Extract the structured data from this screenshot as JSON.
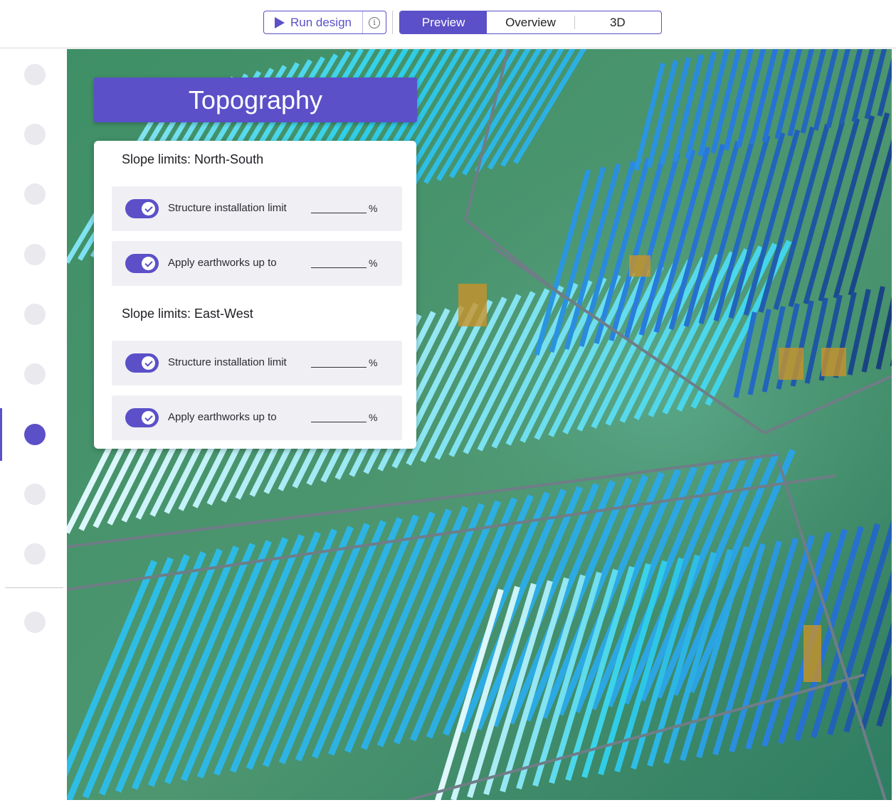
{
  "toolbar": {
    "run_label": "Run design",
    "run_icon": "play-icon",
    "info_icon": "info-icon",
    "info_glyph": "i",
    "tabs": [
      {
        "label": "Preview",
        "active": true
      },
      {
        "label": "Overview",
        "active": false
      },
      {
        "label": "3D",
        "active": false
      }
    ]
  },
  "rail": {
    "steps_active_index": 6,
    "step_count": 10
  },
  "panel": {
    "title": "Topography",
    "sections": [
      {
        "label": "Slope limits: North-South",
        "rows": [
          {
            "label": "Structure installation limit",
            "value": "",
            "unit": "%",
            "enabled": true
          },
          {
            "label": "Apply earthworks up to",
            "value": "",
            "unit": "%",
            "enabled": true
          }
        ]
      },
      {
        "label": "Slope limits: East-West",
        "rows": [
          {
            "label": "Structure installation limit",
            "value": "",
            "unit": "%",
            "enabled": true
          },
          {
            "label": "Apply earthworks up to",
            "value": "",
            "unit": "%",
            "enabled": true
          }
        ]
      }
    ]
  },
  "colors": {
    "accent": "#5b50c8",
    "terrain": "#4f9168",
    "road": "#6f7d86",
    "panel_low": "#ffffff",
    "panel_mid": "#2fd0e8",
    "panel_high": "#0f2147",
    "earthwork": "#c9922a"
  }
}
